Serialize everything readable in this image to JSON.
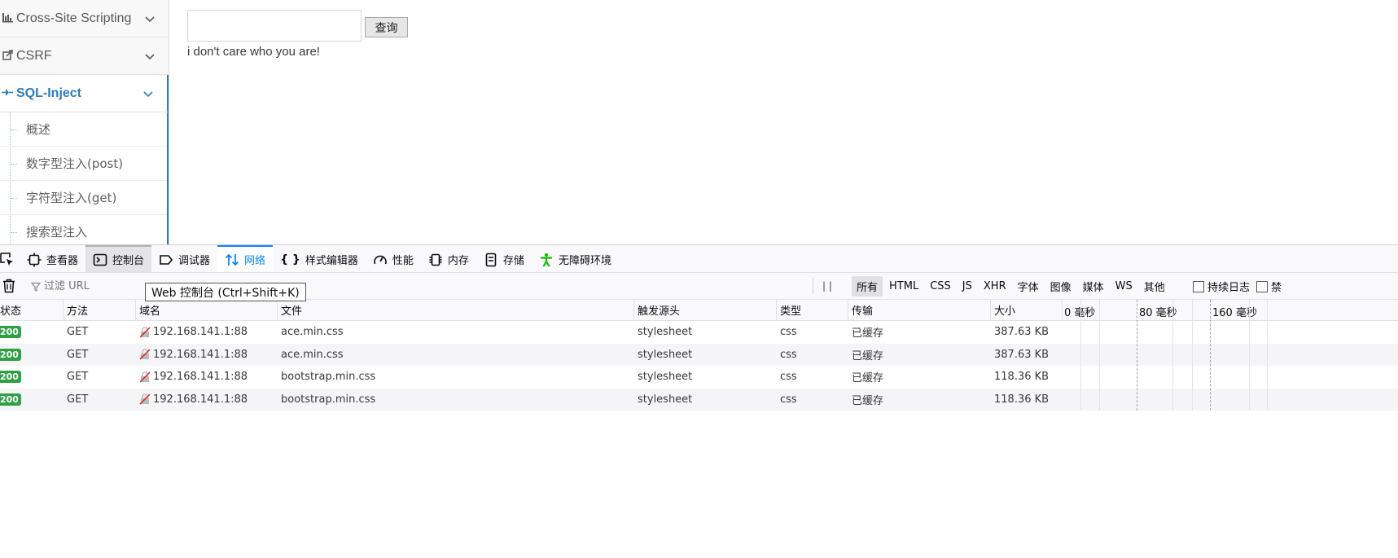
{
  "sidebar": {
    "items": [
      {
        "label": "Cross-Site Scripting",
        "icon": "bar-chart-icon",
        "active": false
      },
      {
        "label": "CSRF",
        "icon": "share-icon",
        "active": false
      },
      {
        "label": "SQL-Inject",
        "icon": "plug-icon",
        "active": true
      }
    ],
    "submenu": [
      "概述",
      "数字型注入(post)",
      "字符型注入(get)",
      "搜索型注入"
    ]
  },
  "main": {
    "query_value": "",
    "query_button": "查询",
    "result_text": "i don't care who you are!"
  },
  "devtools": {
    "tabs": [
      {
        "label": "查看器",
        "icon": "inspector-icon"
      },
      {
        "label": "控制台",
        "icon": "console-icon"
      },
      {
        "label": "调试器",
        "icon": "debugger-icon"
      },
      {
        "label": "网络",
        "icon": "network-icon"
      },
      {
        "label": "样式编辑器",
        "icon": "style-editor-icon"
      },
      {
        "label": "性能",
        "icon": "performance-icon"
      },
      {
        "label": "内存",
        "icon": "memory-icon"
      },
      {
        "label": "存储",
        "icon": "storage-icon"
      },
      {
        "label": "无障碍环境",
        "icon": "accessibility-icon"
      }
    ],
    "filter_placeholder": "过滤 URL",
    "tooltip": "Web 控制台 (Ctrl+Shift+K)",
    "pause": "| |",
    "type_filters": [
      "所有",
      "HTML",
      "CSS",
      "JS",
      "XHR",
      "字体",
      "图像",
      "媒体",
      "WS",
      "其他"
    ],
    "persist_log": "持续日志",
    "disable_cache_fragment": "禁",
    "columns": [
      "状态",
      "方法",
      "域名",
      "文件",
      "触发源头",
      "类型",
      "传输",
      "大小"
    ],
    "waterfall_ticks": [
      "0 毫秒",
      "80 毫秒",
      "160 毫秒"
    ],
    "requests": [
      {
        "status": "200",
        "method": "GET",
        "domain": "192.168.141.1:88",
        "file": "ace.min.css",
        "cause": "stylesheet",
        "type": "css",
        "transferred": "已缓存",
        "size": "387.63 KB"
      },
      {
        "status": "200",
        "method": "GET",
        "domain": "192.168.141.1:88",
        "file": "ace.min.css",
        "cause": "stylesheet",
        "type": "css",
        "transferred": "已缓存",
        "size": "387.63 KB"
      },
      {
        "status": "200",
        "method": "GET",
        "domain": "192.168.141.1:88",
        "file": "bootstrap.min.css",
        "cause": "stylesheet",
        "type": "css",
        "transferred": "已缓存",
        "size": "118.36 KB"
      },
      {
        "status": "200",
        "method": "GET",
        "domain": "192.168.141.1:88",
        "file": "bootstrap.min.css",
        "cause": "stylesheet",
        "type": "css",
        "transferred": "已缓存",
        "size": "118.36 KB"
      }
    ]
  },
  "colors": {
    "accent": "#2b7dbc",
    "devtools_selected": "#0a84ff",
    "status_ok": "#2ea146"
  }
}
